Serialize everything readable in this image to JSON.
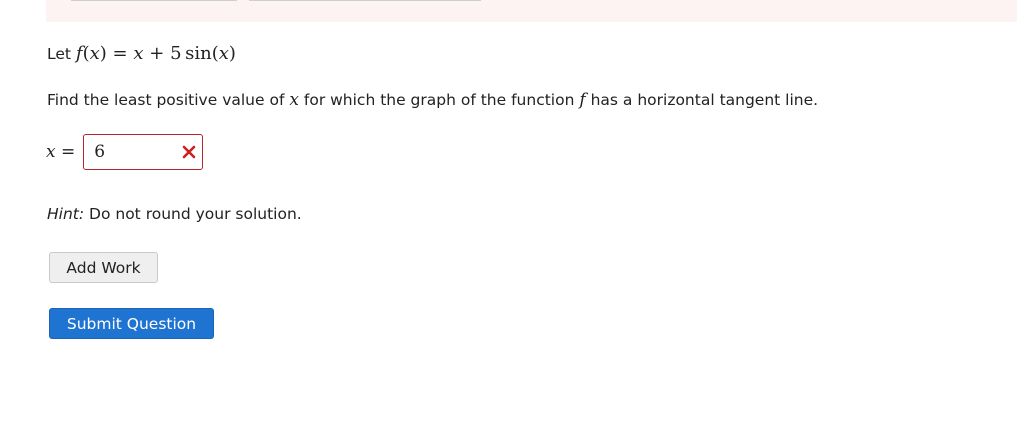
{
  "question": {
    "intro": "Let",
    "function_name": "f",
    "variable": "x",
    "rhs_linear": "x",
    "plus": "+",
    "coefficient": "5",
    "func_sin": "sin",
    "prompt_pre": "Find the least positive value of",
    "prompt_mid": "for which the graph of the function",
    "prompt_post": "has a horizontal tangent line."
  },
  "answer": {
    "label_var": "x",
    "label_eq": "=",
    "value": "6",
    "status": "incorrect",
    "status_color": "#cc1f1f"
  },
  "hint": {
    "label": "Hint:",
    "text": "Do not round your solution."
  },
  "buttons": {
    "add_work": "Add Work",
    "submit": "Submit Question"
  },
  "colors": {
    "primary_button": "#1f74d1",
    "error_border": "#b3262c",
    "banner": "#fdf3f3"
  }
}
